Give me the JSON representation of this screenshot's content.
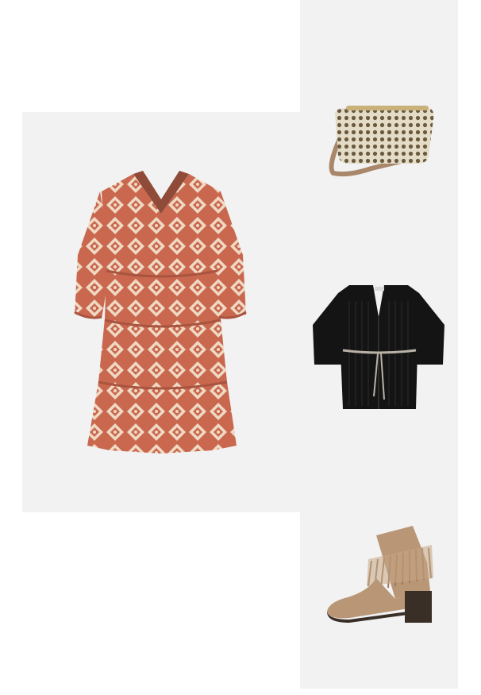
{
  "outfit": {
    "items": [
      {
        "product": "dress",
        "icon": "dress-image",
        "colors": {
          "base": "#c9674f",
          "pattern": "#f0d9c2",
          "tile": "#f2f2f2"
        }
      },
      {
        "product": "bag",
        "icon": "bag-image",
        "colors": {
          "straw": "#e5dcc7",
          "weave": "#6a5a3f",
          "strap": "#a8876a",
          "tile": "#f2f2f2"
        }
      },
      {
        "product": "cardigan",
        "icon": "cardigan-image",
        "colors": {
          "knit": "#141414",
          "belt": "#b9b2a6",
          "tile": "#f2f2f2"
        }
      },
      {
        "product": "boots",
        "icon": "boot-image",
        "colors": {
          "suede": "#b89676",
          "sole": "#3a2f27",
          "tile": "#f2f2f2"
        }
      }
    ]
  }
}
